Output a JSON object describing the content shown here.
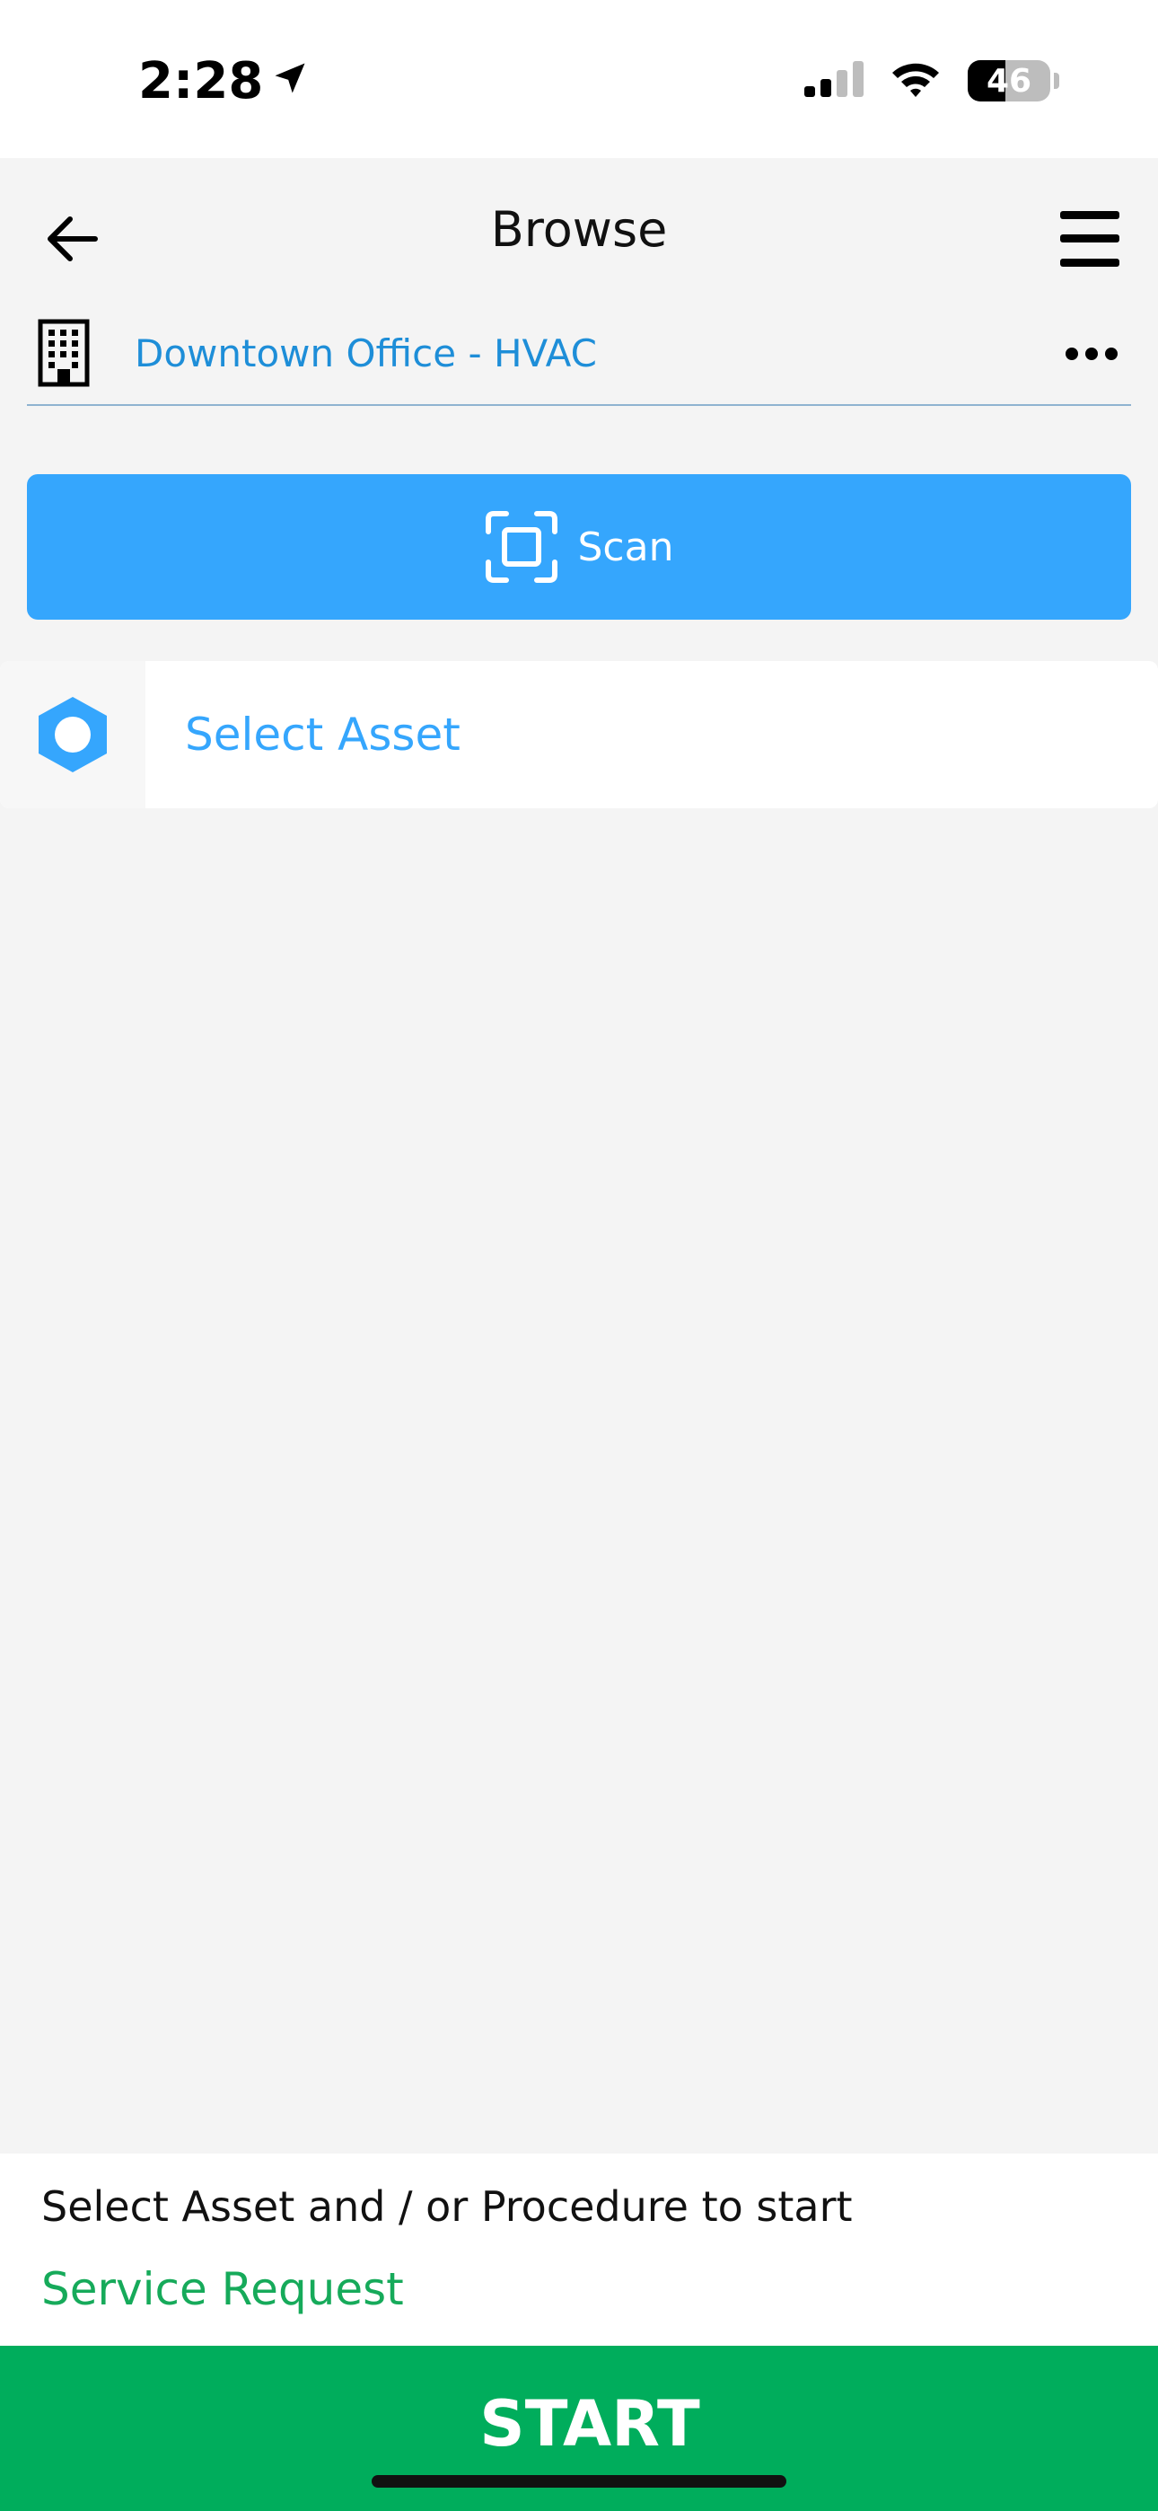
{
  "status_bar": {
    "time": "2:28",
    "location_icon": "location-arrow-icon",
    "signal_icon": "cellular-signal-icon",
    "wifi_icon": "wifi-icon",
    "battery_level": "46",
    "battery_fraction": 0.46
  },
  "header": {
    "title": "Browse",
    "back_icon": "arrow-left-icon",
    "menu_icon": "hamburger-menu-icon"
  },
  "location": {
    "name": "Downtown Office - HVAC",
    "icon": "building-icon",
    "more_icon": "ellipsis-icon"
  },
  "scan": {
    "label": "Scan",
    "icon": "scan-frame-icon"
  },
  "asset": {
    "label": "Select Asset",
    "icon": "hexagon-icon"
  },
  "footer": {
    "hint": "Select Asset and / or Procedure to start",
    "service_request": "Service Request",
    "start_label": "START"
  },
  "colors": {
    "accent_blue": "#35a6fd",
    "link_blue": "#1e8ed8",
    "green": "#00ad5c",
    "green_text": "#16aa5a",
    "background": "#f4f4f4"
  }
}
